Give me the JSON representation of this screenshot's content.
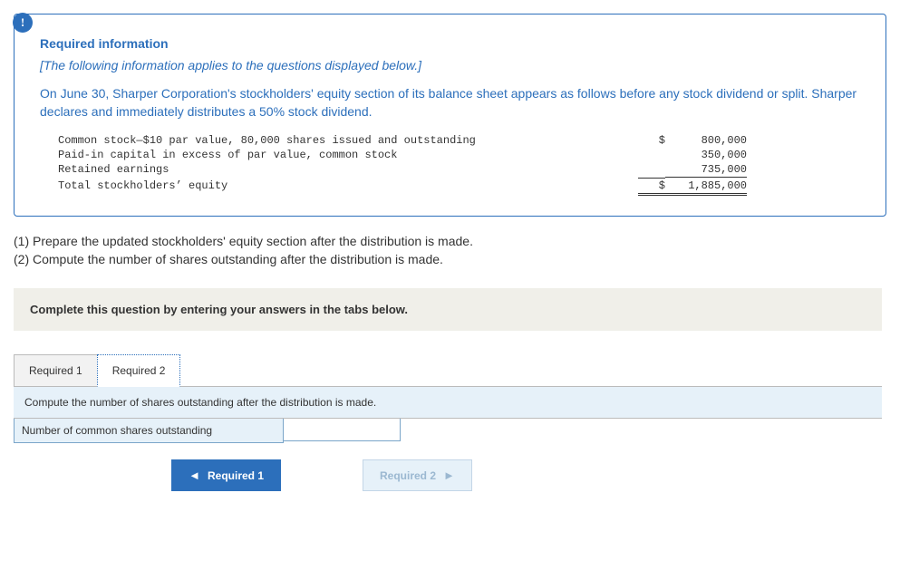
{
  "badge": "!",
  "req_title": "Required information",
  "italic_note": "[The following information applies to the questions displayed below.]",
  "body_text": "On June 30, Sharper Corporation's stockholders' equity section of its balance sheet appears as follows before any stock dividend or split. Sharper declares and immediately distributes a 50% stock dividend.",
  "ledger": {
    "r1": {
      "label": "Common stock—$10 par value, 80,000 shares issued and outstanding",
      "cur": "$",
      "amt": "800,000"
    },
    "r2": {
      "label": "Paid-in capital in excess of par value, common stock",
      "cur": "",
      "amt": "350,000"
    },
    "r3": {
      "label": "Retained earnings",
      "cur": "",
      "amt": "735,000"
    },
    "r4": {
      "label": "Total stockholders’ equity",
      "cur": "$",
      "amt": "1,885,000"
    }
  },
  "questions": "(1) Prepare the updated stockholders' equity section after the distribution is made.\n(2) Compute the number of shares outstanding after the distribution is made.",
  "instr": "Complete this question by entering your answers in the tabs below.",
  "tabs": {
    "t1": "Required 1",
    "t2": "Required 2"
  },
  "panel_head": "Compute the number of shares outstanding after the distribution is made.",
  "answer_label": "Number of common shares outstanding",
  "answer_value": "",
  "nav": {
    "prev": "Required 1",
    "next": "Required 2"
  }
}
